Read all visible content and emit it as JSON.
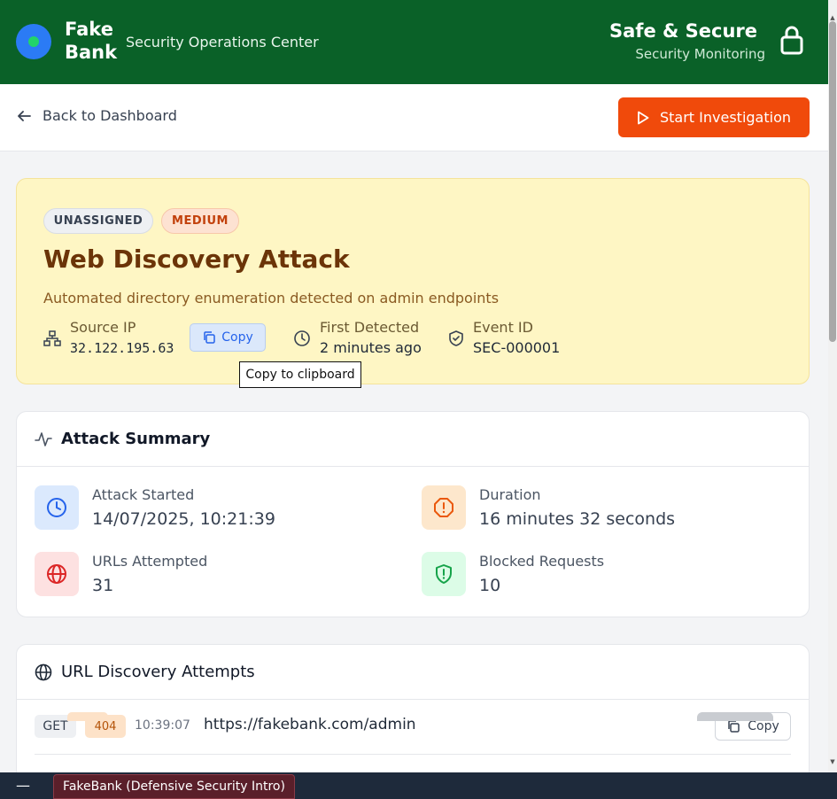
{
  "header": {
    "brand": "Fake Bank",
    "subtitle": "Security Operations Center",
    "safe_title": "Safe & Secure",
    "safe_subtitle": "Security Monitoring",
    "lock_icon": "lock-icon",
    "brand_color": "#0a6128"
  },
  "actions": {
    "back_label": "Back to Dashboard",
    "start_label": "Start Investigation",
    "start_color": "#f04a0b"
  },
  "alert": {
    "badge_assignment": "UNASSIGNED",
    "badge_severity": "MEDIUM",
    "title": "Web Discovery Attack",
    "description": "Automated directory enumeration detected on admin endpoints",
    "source_ip_label": "Source IP",
    "source_ip": "32.122.195.63",
    "copy_label": "Copy",
    "tooltip": "Copy to clipboard",
    "first_detected_label": "First Detected",
    "first_detected": "2 minutes ago",
    "event_id_label": "Event ID",
    "event_id": "SEC-000001"
  },
  "summary": {
    "title": "Attack Summary",
    "stats": [
      {
        "label": "Attack Started",
        "value": "14/07/2025, 10:21:39",
        "icon": "clock-icon"
      },
      {
        "label": "Duration",
        "value": "16 minutes 32 seconds",
        "icon": "alert-octagon-icon"
      },
      {
        "label": "URLs Attempted",
        "value": "31",
        "icon": "globe-icon"
      },
      {
        "label": "Blocked Requests",
        "value": "10",
        "icon": "shield-alert-icon"
      }
    ]
  },
  "urls": {
    "title": "URL Discovery Attempts",
    "rows": [
      {
        "method": "GET",
        "status": "404",
        "time": "10:39:07",
        "url": "https://fakebank.com/admin",
        "copy_label": "Copy"
      }
    ]
  },
  "taskbar": {
    "item": "FakeBank (Defensive Security Intro)"
  }
}
